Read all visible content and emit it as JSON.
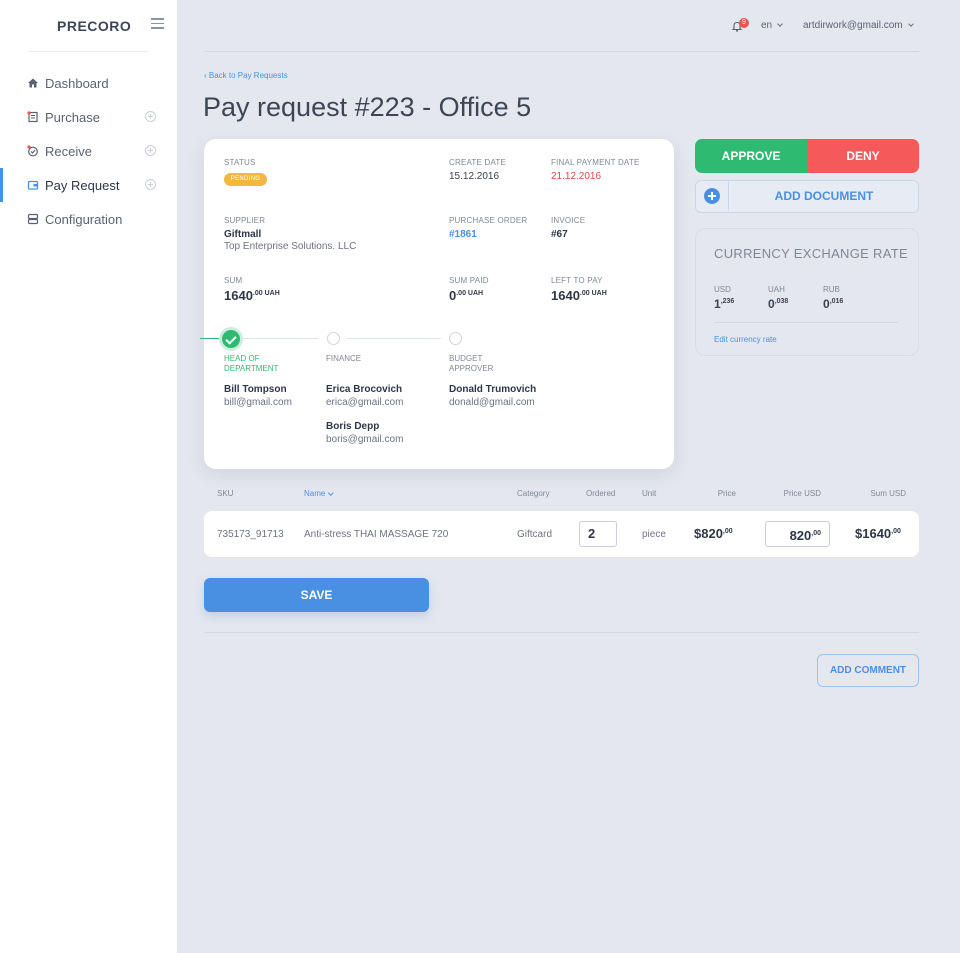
{
  "app": {
    "logo": "PRECORO"
  },
  "sidebar": {
    "items": [
      {
        "label": "Dashboard",
        "icon": "home-icon"
      },
      {
        "label": "Purchase",
        "icon": "purchase-icon"
      },
      {
        "label": "Receive",
        "icon": "receive-icon"
      },
      {
        "label": "Pay Request",
        "icon": "wallet-icon",
        "active": true
      },
      {
        "label": "Configuration",
        "icon": "server-icon"
      }
    ]
  },
  "topbar": {
    "notifications": "9",
    "language": "en",
    "user_email": "artdirwork@gmail.com"
  },
  "header": {
    "back_link": "Back to Pay Requests",
    "title": "Pay request #223 - Office 5"
  },
  "details": {
    "status_label": "STATUS",
    "status_value": "PENDING",
    "create_date_label": "CREATE DATE",
    "create_date": "15.12.2016",
    "final_payment_label": "FINAL PAYMENT DATE",
    "final_payment_date": "21.12.2016",
    "supplier_label": "SUPPLIER",
    "supplier_name": "Giftmall",
    "supplier_company": "Top Enterprise Solutions. LLC",
    "po_label": "PURCHASE ORDER",
    "po_value": "#1861",
    "invoice_label": "INVOICE",
    "invoice_value": "#67",
    "sum_label": "SUM",
    "sum_main": "1640",
    "sum_sup": ".00 UAH",
    "sum_paid_label": "SUM PAID",
    "sum_paid_main": "0",
    "sum_paid_sup": ".00 UAH",
    "left_label": "LEFT TO PAY",
    "left_main": "1640",
    "left_sup": ".00 UAH"
  },
  "approval": {
    "steps": [
      {
        "label_1": "HEAD OF",
        "label_2": "DEPARTMENT",
        "done": true
      },
      {
        "label_1": "FINANCE",
        "label_2": ""
      },
      {
        "label_1": "BUDGET",
        "label_2": "APPROVER"
      }
    ],
    "people": [
      {
        "name": "Bill Tompson",
        "email": "bill@gmail.com"
      },
      {
        "name": "Erica Brocovich",
        "email": "erica@gmail.com"
      },
      {
        "name": "Donald Trumovich",
        "email": "donald@gmail.com"
      },
      {
        "name": "Boris Depp",
        "email": "boris@gmail.com"
      }
    ]
  },
  "actions": {
    "approve": "APPROVE",
    "deny": "DENY",
    "add_document": "ADD DOCUMENT",
    "save": "SAVE",
    "add_comment": "ADD COMMENT"
  },
  "currency": {
    "title": "CURRENCY EXCHANGE RATE",
    "rates": [
      {
        "code": "USD",
        "main": "1",
        "sup": ",236"
      },
      {
        "code": "UAH",
        "main": "0",
        "sup": ",038"
      },
      {
        "code": "RUB",
        "main": "0",
        "sup": ",016"
      }
    ],
    "edit_link": "Edit currency rate"
  },
  "table": {
    "headers": {
      "sku": "SKU",
      "name": "Name",
      "category": "Category",
      "ordered": "Ordered",
      "unit": "Unit",
      "price": "Price",
      "price_usd": "Price USD",
      "sum_usd": "Sum USD"
    },
    "rows": [
      {
        "sku": "735173_91713",
        "name": "Anti-stress THAI MASSAGE 720",
        "category": "Giftcard",
        "ordered": "2",
        "unit": "piece",
        "price_main": "$820",
        "price_sup": ",00",
        "price_usd_main": "820",
        "price_usd_sup": ",00",
        "sum_main": "$1640",
        "sum_sup": ",00"
      }
    ]
  },
  "colors": {
    "accent": "#4a90e2",
    "approve": "#2fba72",
    "deny": "#f6595a",
    "pending": "#f5b73b",
    "overdue": "#e04848"
  }
}
